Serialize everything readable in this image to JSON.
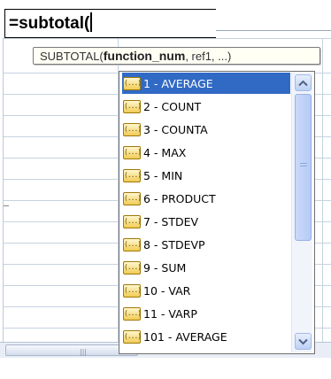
{
  "formula_bar": {
    "text": "=subtotal("
  },
  "tooltip": {
    "prefix": "SUBTOTAL(",
    "current_arg": "function_num",
    "rest": ", ref1, ...)"
  },
  "autocomplete": {
    "items": [
      {
        "label": "1 - AVERAGE",
        "selected": true
      },
      {
        "label": "2 - COUNT",
        "selected": false
      },
      {
        "label": "3 - COUNTA",
        "selected": false
      },
      {
        "label": "4 - MAX",
        "selected": false
      },
      {
        "label": "5 - MIN",
        "selected": false
      },
      {
        "label": "6 - PRODUCT",
        "selected": false
      },
      {
        "label": "7 - STDEV",
        "selected": false
      },
      {
        "label": "8 - STDEVP",
        "selected": false
      },
      {
        "label": "9 - SUM",
        "selected": false
      },
      {
        "label": "10 - VAR",
        "selected": false
      },
      {
        "label": "11 - VARP",
        "selected": false
      },
      {
        "label": "101 - AVERAGE",
        "selected": false
      }
    ],
    "icon_glyph": "(...)",
    "icon_name": "function-argument-icon",
    "selection_color": "#316ac5"
  },
  "colors": {
    "icon_fill": "#f1cc55",
    "scrollbar": "#bcd0f3"
  }
}
